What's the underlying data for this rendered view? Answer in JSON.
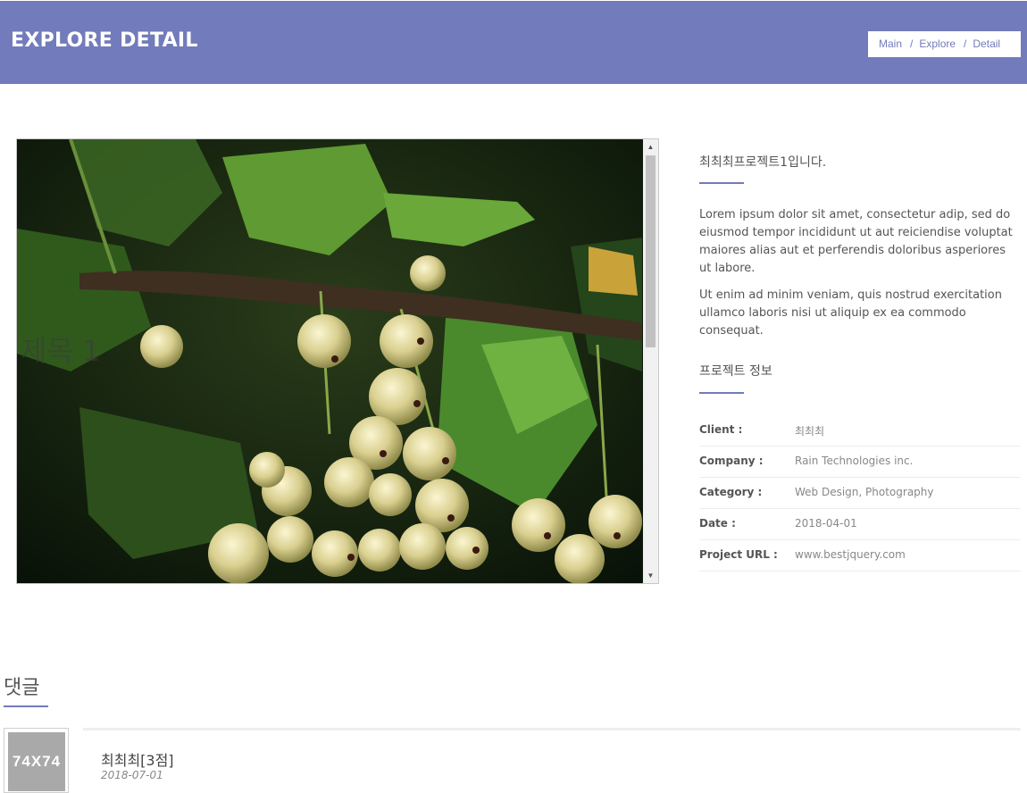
{
  "header": {
    "title": "EXPLORE DETAIL",
    "breadcrumb": [
      "Main",
      "Explore",
      "Detail"
    ],
    "accent_color": "#727bbb"
  },
  "gallery": {
    "overlay_title": "제목 1",
    "image_alt": "currant berries on branch with leaves"
  },
  "project": {
    "title": "최최최프로젝트1입니다.",
    "description": [
      "Lorem ipsum dolor sit amet, consectetur adip, sed do eiusmod tempor incididunt ut aut reiciendise voluptat maiores alias aut et perferendis doloribus asperiores ut labore.",
      "Ut enim ad minim veniam, quis nostrud exercitation ullamco laboris nisi ut aliquip ex ea commodo consequat."
    ],
    "info_heading": "프로젝트 정보",
    "info": [
      {
        "label": "Client :",
        "value": "최최최"
      },
      {
        "label": "Company :",
        "value": "Rain Technologies inc."
      },
      {
        "label": "Category :",
        "value": "Web Design, Photography"
      },
      {
        "label": "Date :",
        "value": "2018-04-01"
      },
      {
        "label": "Project URL :",
        "value": "www.bestjquery.com"
      }
    ]
  },
  "comments": {
    "heading": "댓글",
    "items": [
      {
        "avatar_text": "74X74",
        "author": "최최최[3점]",
        "date": "2018-07-01"
      }
    ]
  }
}
